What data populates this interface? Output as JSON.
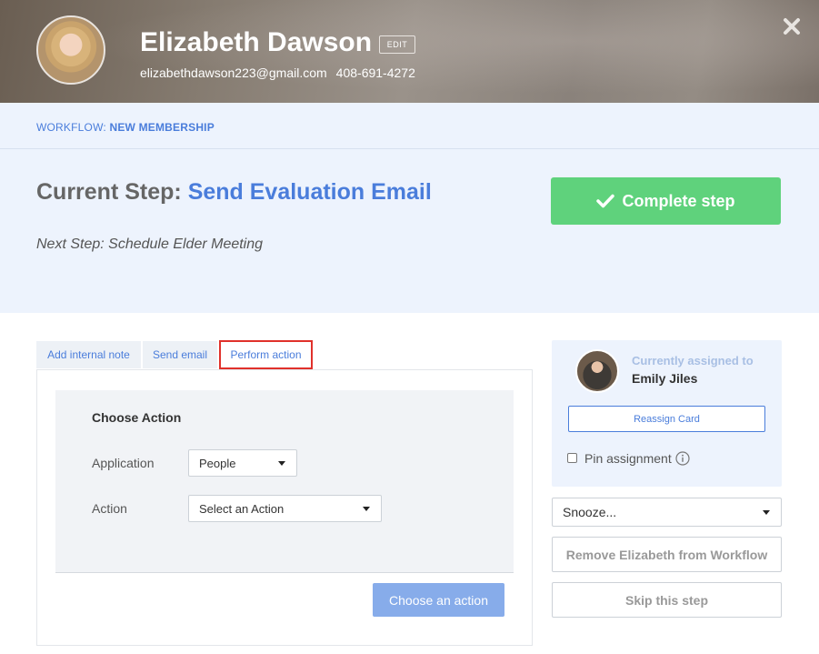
{
  "header": {
    "name": "Elizabeth Dawson",
    "edit_label": "EDIT",
    "email": "elizabethdawson223@gmail.com",
    "phone": "408-691-4272"
  },
  "workflow": {
    "prefix": "WORKFLOW: ",
    "name": "NEW MEMBERSHIP"
  },
  "step": {
    "current_prefix": "Current Step: ",
    "current_name": "Send Evaluation Email",
    "next": "Next Step: Schedule Elder Meeting",
    "complete_label": "Complete step"
  },
  "tabs": [
    {
      "label": "Add internal note",
      "active": false
    },
    {
      "label": "Send email",
      "active": false
    },
    {
      "label": "Perform action",
      "active": true
    }
  ],
  "action_form": {
    "title": "Choose Action",
    "application_label": "Application",
    "application_value": "People",
    "action_label": "Action",
    "action_value": "Select an Action",
    "submit_label": "Choose an action"
  },
  "assignment": {
    "label": "Currently assigned to",
    "assignee": "Emily Jiles",
    "reassign_label": "Reassign Card",
    "pin_label": "Pin assignment",
    "pinned": false
  },
  "sidebar_actions": {
    "snooze_value": "Snooze...",
    "remove_label": "Remove Elizabeth from Workflow",
    "skip_label": "Skip this step"
  },
  "colors": {
    "accent": "#4a7ddb",
    "complete_green": "#5fd27c",
    "light_bg": "#edf3fd",
    "highlight_red": "#e0312b"
  }
}
